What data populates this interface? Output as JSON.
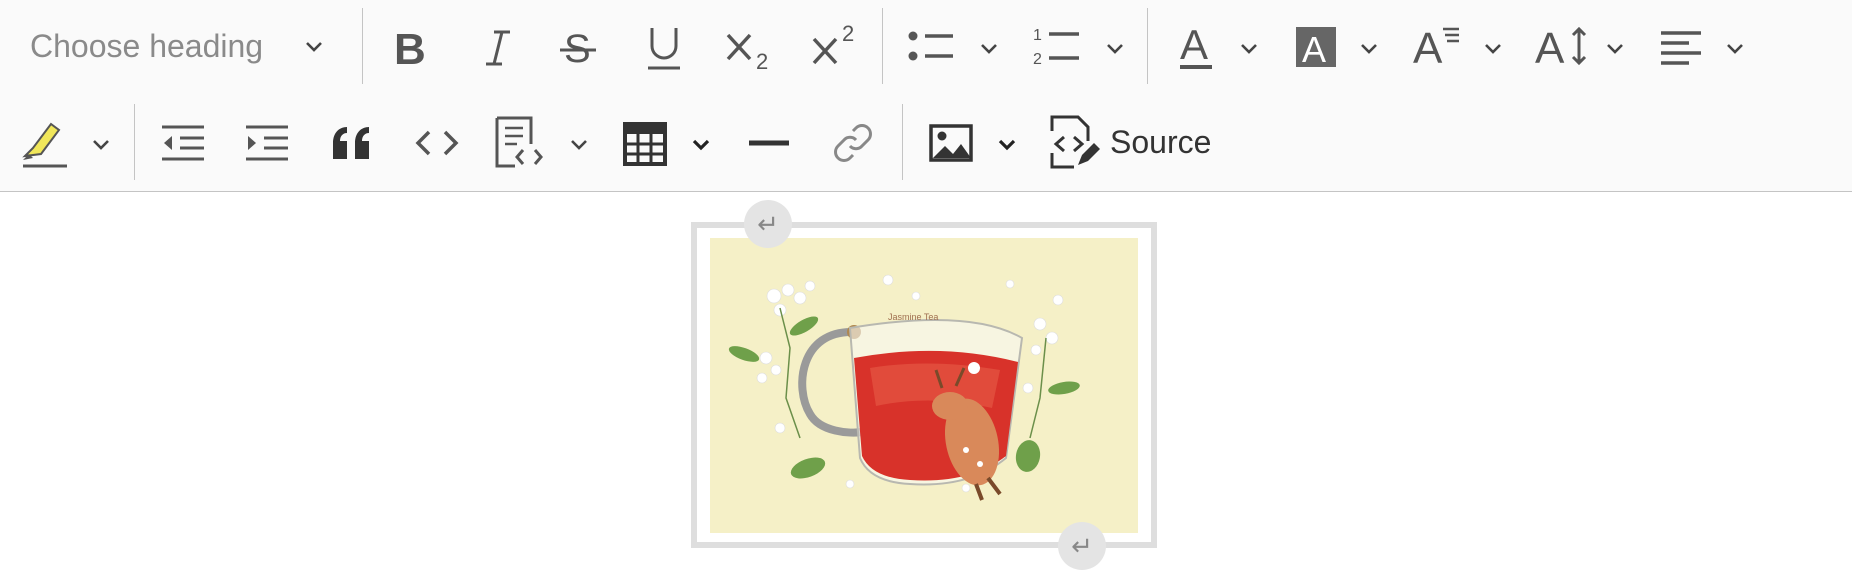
{
  "toolbar": {
    "heading": {
      "label": "Choose heading"
    },
    "source_label": "Source",
    "icons": [
      "bold-icon",
      "italic-icon",
      "strikethrough-icon",
      "underline-icon",
      "subscript-icon",
      "superscript-icon",
      "bulleted-list-icon",
      "numbered-list-icon",
      "font-color-icon",
      "font-background-color-icon",
      "font-family-icon",
      "font-size-icon",
      "alignment-icon",
      "highlight-icon",
      "outdent-icon",
      "indent-icon",
      "block-quote-icon",
      "code-icon",
      "insert-template-icon",
      "table-icon",
      "horizontal-line-icon",
      "link-icon",
      "image-icon",
      "source-icon"
    ],
    "colors": {
      "highlight": "#f1e75a",
      "icon": "#333333",
      "separator": "#c4c4c4",
      "toolbar_bg": "#fafafa"
    }
  },
  "content": {
    "image": {
      "caption_text": "Jasmine Tea"
    },
    "caret_glyph": "↵"
  }
}
